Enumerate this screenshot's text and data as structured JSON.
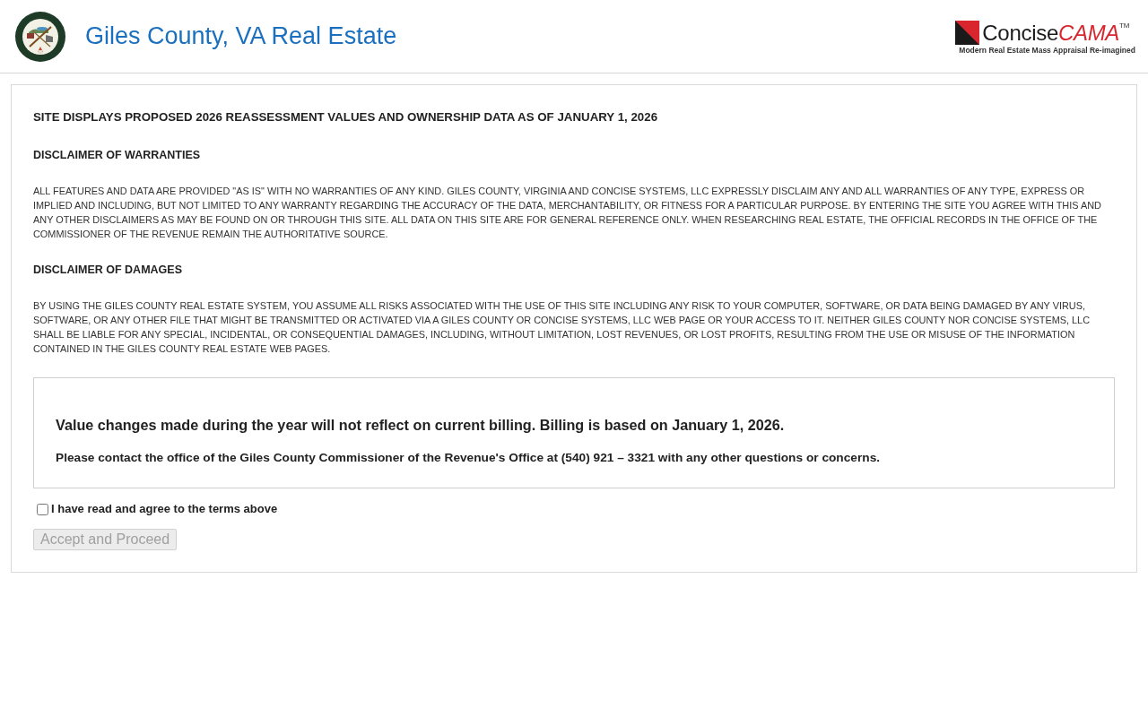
{
  "header": {
    "title": "Giles County, VA Real Estate",
    "brand": {
      "name": "Concise",
      "accent": "CAMA",
      "trademark": "TM",
      "tagline": "Modern Real Estate Mass Appraisal Re-imagined"
    }
  },
  "notice_page": {
    "headline": "SITE DISPLAYS PROPOSED 2026 REASSESSMENT VALUES AND OWNERSHIP DATA AS OF JANUARY 1, 2026",
    "sections": [
      {
        "heading": "DISCLAIMER OF WARRANTIES",
        "body": "ALL FEATURES AND DATA ARE PROVIDED \"AS IS\" WITH NO WARRANTIES OF ANY KIND. GILES COUNTY, VIRGINIA AND CONCISE SYSTEMS, LLC EXPRESSLY DISCLAIM ANY AND ALL WARRANTIES OF ANY TYPE, EXPRESS OR IMPLIED AND INCLUDING, BUT NOT LIMITED TO ANY WARRANTY REGARDING THE ACCURACY OF THE DATA, MERCHANTABILITY, OR FITNESS FOR A PARTICULAR PURPOSE. BY ENTERING THE SITE YOU AGREE WITH THIS AND ANY OTHER DISCLAIMERS AS MAY BE FOUND ON OR THROUGH THIS SITE. ALL DATA ON THIS SITE ARE FOR GENERAL REFERENCE ONLY. WHEN RESEARCHING REAL ESTATE, THE OFFICIAL RECORDS IN THE OFFICE OF THE COMMISSIONER OF THE REVENUE REMAIN THE AUTHORITATIVE SOURCE."
      },
      {
        "heading": "DISCLAIMER OF DAMAGES",
        "body": "BY USING THE GILES COUNTY REAL ESTATE SYSTEM, YOU ASSUME ALL RISKS ASSOCIATED WITH THE USE OF THIS SITE INCLUDING ANY RISK TO YOUR COMPUTER, SOFTWARE, OR DATA BEING DAMAGED BY ANY VIRUS, SOFTWARE, OR ANY OTHER FILE THAT MIGHT BE TRANSMITTED OR ACTIVATED VIA A GILES COUNTY OR CONCISE SYSTEMS, LLC WEB PAGE OR YOUR ACCESS TO IT. NEITHER GILES COUNTY NOR CONCISE SYSTEMS, LLC SHALL BE LIABLE FOR ANY SPECIAL, INCIDENTAL, OR CONSEQUENTIAL DAMAGES, INCLUDING, WITHOUT LIMITATION, LOST REVENUES, OR LOST PROFITS, RESULTING FROM THE USE OR MISUSE OF THE INFORMATION CONTAINED IN THE GILES COUNTY REAL ESTATE WEB PAGES."
      }
    ],
    "callout": {
      "message": "Value changes made during the year will not reflect on current billing. Billing is based on January 1, 2026.",
      "contact": "Please contact the office of the Giles County Commissioner of the Revenue's Office at (540) 921 – 3321 with any other questions or concerns."
    },
    "agreement": {
      "label": "I have read and agree to the terms above",
      "checked": false
    },
    "proceed_button": {
      "label": "Accept and Proceed",
      "disabled": true
    }
  }
}
